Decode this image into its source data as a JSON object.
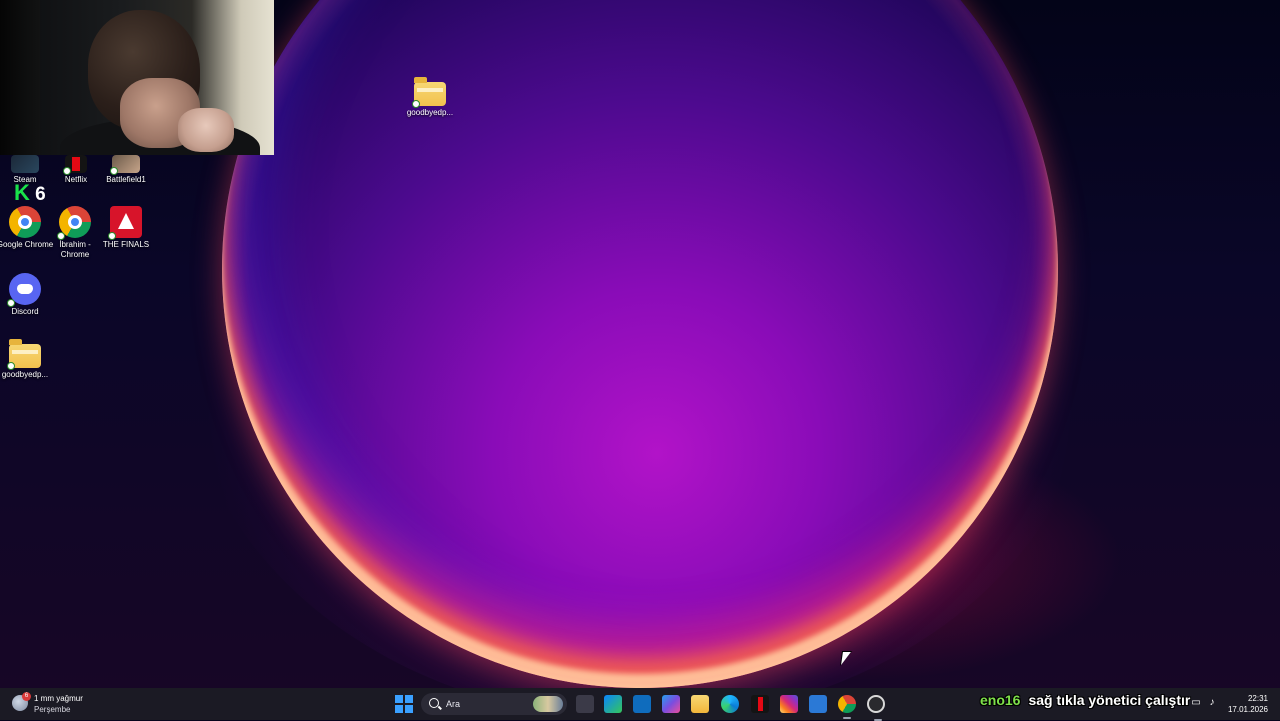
{
  "desktop": {
    "icons_top": [
      {
        "label": "goodbyedp...",
        "icon": "folder-icon"
      }
    ],
    "icons_left": [
      {
        "label": "Steam",
        "icon": "steam-icon"
      },
      {
        "label": "Netflix",
        "icon": "netflix-icon"
      },
      {
        "label": "Battlefield1",
        "icon": "battlefield-icon"
      },
      {
        "label": "Google Chrome",
        "icon": "chrome-icon"
      },
      {
        "label": "İbrahim - Chrome",
        "icon": "chrome-profile-icon"
      },
      {
        "label": "THE FINALS",
        "icon": "the-finals-icon"
      },
      {
        "label": "Discord",
        "icon": "discord-icon"
      },
      {
        "label": "goodbyedp...",
        "icon": "folder-icon"
      }
    ],
    "k6_overlay": {
      "k": "K",
      "num": "6"
    }
  },
  "taskbar": {
    "weather": {
      "badge": "6",
      "line1": "1 mm yağmur",
      "line2": "Perşembe"
    },
    "search_placeholder": "Ara",
    "apps": [
      "task-view-icon",
      "store-icon",
      "outlook-icon",
      "m365-icon",
      "file-explorer-icon",
      "edge-icon",
      "netflix-icon",
      "instagram-icon",
      "calendar-icon",
      "chrome-icon",
      "obs-icon"
    ],
    "clock": {
      "time": "22:31",
      "date": "17.01.2026"
    }
  },
  "stream_overlay": {
    "username": "eno16",
    "message": "sağ tıkla yönetici çalıştır"
  },
  "colors": {
    "taskbar_bg": "#1b1a24",
    "accent": "#3aa0ff",
    "overlay_user": "#7ee04a"
  }
}
